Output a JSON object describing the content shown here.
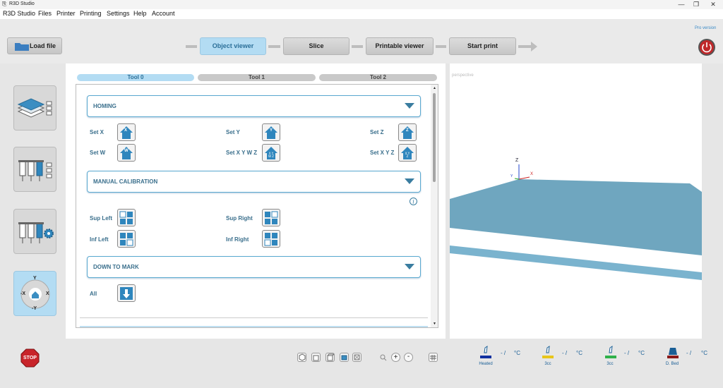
{
  "window": {
    "title": "R3D Studio",
    "controls": [
      "—",
      "❐",
      "✕"
    ]
  },
  "menu": [
    "R3D Studio",
    "Files",
    "Printer",
    "Printing",
    "Settings",
    "Help",
    "Account"
  ],
  "toolbar": {
    "load_file": "Load file",
    "steps": [
      "Object viewer",
      "Slice",
      "Printable viewer",
      "Start print"
    ],
    "pro_label": "Pro version"
  },
  "tool_tabs": [
    "Tool 0",
    "Tool 1",
    "Tool 2"
  ],
  "sections": {
    "homing": "HOMING",
    "manual": "MANUAL CALIBRATION",
    "down": "DOWN TO MARK"
  },
  "homing": {
    "set_x": "Set X",
    "set_y": "Set Y",
    "set_z": "Set Z",
    "set_w": "Set W",
    "set_xywz": "Set X Y W Z",
    "set_xyz": "Set X Y Z",
    "icon_x": "X",
    "icon_y": "Y",
    "icon_z": "Z",
    "icon_w": "W"
  },
  "manual": {
    "sup_left": "Sup Left",
    "sup_right": "Sup Right",
    "inf_left": "Inf Left",
    "inf_right": "Inf Right"
  },
  "down": {
    "all": "All"
  },
  "viewer": {
    "label": "perspective",
    "axis_z": "Z",
    "axis_y": "Y",
    "axis_x": "X"
  },
  "jog": {
    "y": "Y",
    "neg_y": "-Y",
    "x": "X",
    "neg_x": "-X"
  },
  "bottom": {
    "stop": "STOP",
    "temps": [
      {
        "label": "Heated",
        "value": "-",
        "sep": "/",
        "unit": "°C",
        "color": "#1030a0"
      },
      {
        "label": "3cc",
        "value": "-",
        "sep": "/",
        "unit": "°C",
        "color": "#e8c61a"
      },
      {
        "label": "3cc",
        "value": "-",
        "sep": "/",
        "unit": "°C",
        "color": "#2fb14a"
      },
      {
        "label": "D. Bed",
        "value": "-",
        "sep": "/",
        "unit": "°C",
        "color": "#8a1a1a"
      }
    ]
  },
  "colors": {
    "accent": "#3a7da0",
    "active_tab": "#b3dcf3",
    "bed": "#6fa6bf"
  }
}
